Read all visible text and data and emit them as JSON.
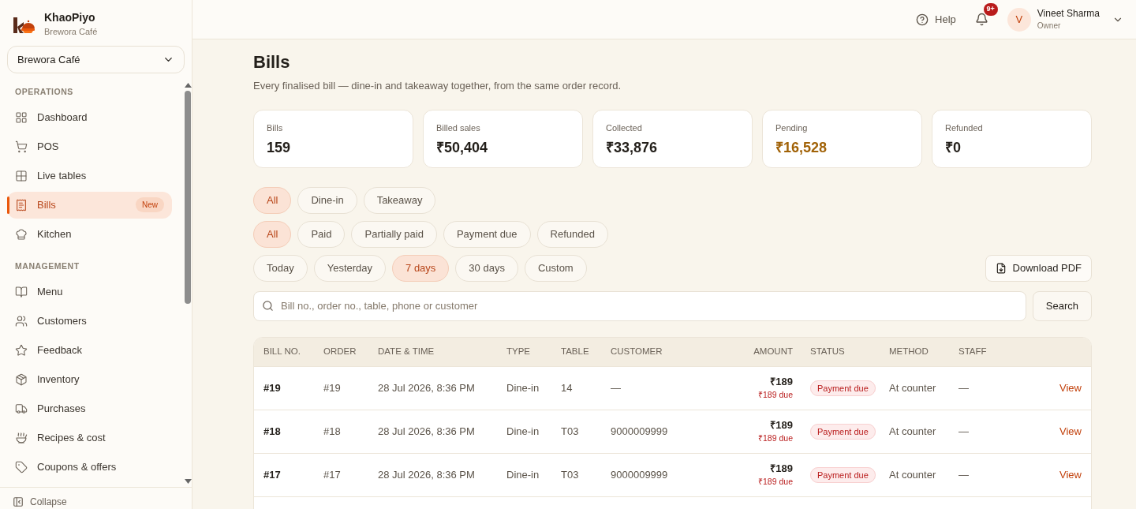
{
  "brand": {
    "name": "KhaoPiyo",
    "outlet": "Brewora Café"
  },
  "outlet_select": {
    "value": "Brewora Café"
  },
  "sidebar": {
    "sections": [
      {
        "title": "OPERATIONS",
        "items": [
          {
            "label": "Dashboard",
            "selected": false
          },
          {
            "label": "POS",
            "selected": false
          },
          {
            "label": "Live tables",
            "selected": false
          },
          {
            "label": "Bills",
            "selected": true,
            "badge": "New"
          },
          {
            "label": "Kitchen",
            "selected": false
          }
        ]
      },
      {
        "title": "MANAGEMENT",
        "items": [
          {
            "label": "Menu",
            "selected": false
          },
          {
            "label": "Customers",
            "selected": false
          },
          {
            "label": "Feedback",
            "selected": false
          },
          {
            "label": "Inventory",
            "selected": false
          },
          {
            "label": "Purchases",
            "selected": false
          },
          {
            "label": "Recipes & cost",
            "selected": false
          },
          {
            "label": "Coupons & offers",
            "selected": false
          }
        ]
      }
    ],
    "collapse": "Collapse"
  },
  "header": {
    "help": "Help",
    "notifications": "9+",
    "user": {
      "initial": "V",
      "name": "Vineet Sharma",
      "role": "Owner"
    }
  },
  "page": {
    "title": "Bills",
    "subtitle": "Every finalised bill — dine-in and takeaway together, from the same order record."
  },
  "stats": [
    {
      "label": "Bills",
      "value": "159",
      "kind": "normal"
    },
    {
      "label": "Billed sales",
      "value": "₹50,404",
      "kind": "normal"
    },
    {
      "label": "Collected",
      "value": "₹33,876",
      "kind": "normal"
    },
    {
      "label": "Pending",
      "value": "₹16,528",
      "kind": "warning"
    },
    {
      "label": "Refunded",
      "value": "₹0",
      "kind": "normal"
    }
  ],
  "filters": [
    [
      {
        "label": "All",
        "selected": true
      },
      {
        "label": "Dine-in",
        "selected": false
      },
      {
        "label": "Takeaway",
        "selected": false
      }
    ],
    [
      {
        "label": "All",
        "selected": true
      },
      {
        "label": "Paid",
        "selected": false
      },
      {
        "label": "Partially paid",
        "selected": false
      },
      {
        "label": "Payment due",
        "selected": false
      },
      {
        "label": "Refunded",
        "selected": false
      }
    ],
    [
      {
        "label": "Today",
        "selected": false
      },
      {
        "label": "Yesterday",
        "selected": false
      },
      {
        "label": "7 days",
        "selected": true
      },
      {
        "label": "30 days",
        "selected": false
      },
      {
        "label": "Custom",
        "selected": false
      }
    ]
  ],
  "download": "Download PDF",
  "search": {
    "placeholder": "Bill no., order no., table, phone or customer",
    "button": "Search"
  },
  "table": {
    "columns": [
      "BILL NO.",
      "ORDER",
      "DATE & TIME",
      "TYPE",
      "TABLE",
      "CUSTOMER",
      "AMOUNT",
      "STATUS",
      "METHOD",
      "STAFF"
    ],
    "rows": [
      {
        "bill": "#19",
        "order": "#19",
        "date": "28 Jul 2026, 8:36 PM",
        "type": "Dine-in",
        "table": "14",
        "customer": "—",
        "amount": "₹189",
        "due": "₹189 due",
        "status": "Payment due",
        "method": "At counter",
        "staff": "—",
        "action": "View"
      },
      {
        "bill": "#18",
        "order": "#18",
        "date": "28 Jul 2026, 8:36 PM",
        "type": "Dine-in",
        "table": "T03",
        "customer": "9000009999",
        "amount": "₹189",
        "due": "₹189 due",
        "status": "Payment due",
        "method": "At counter",
        "staff": "—",
        "action": "View"
      },
      {
        "bill": "#17",
        "order": "#17",
        "date": "28 Jul 2026, 8:36 PM",
        "type": "Dine-in",
        "table": "T03",
        "customer": "9000009999",
        "amount": "₹189",
        "due": "₹189 due",
        "status": "Payment due",
        "method": "At counter",
        "staff": "—",
        "action": "View"
      }
    ]
  }
}
